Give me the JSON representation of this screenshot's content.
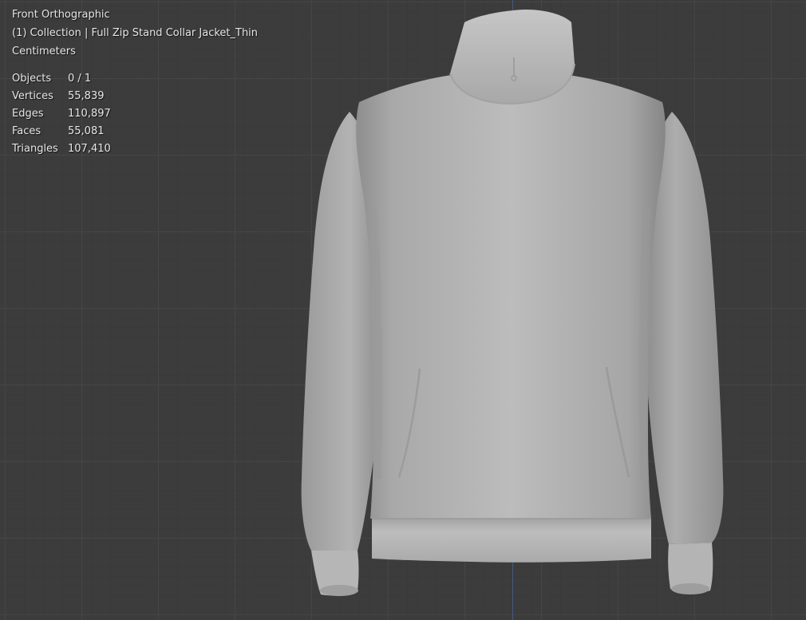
{
  "viewport": {
    "view_name": "Front Orthographic",
    "collection_label": "(1) Collection | Full Zip Stand Collar Jacket_Thin",
    "units": "Centimeters",
    "stats": [
      {
        "label": "Objects",
        "value": "0 / 1"
      },
      {
        "label": "Vertices",
        "value": "55,839"
      },
      {
        "label": "Edges",
        "value": "110,897"
      },
      {
        "label": "Faces",
        "value": "55,081"
      },
      {
        "label": "Triangles",
        "value": "107,410"
      }
    ],
    "colors": {
      "background": "#3c3c3c",
      "grid": "#464646",
      "axis_z": "#3b5fa8",
      "mesh": "#b4b4b4",
      "overlay_text": "#e6e6e6"
    },
    "model_icon": "jacket-mesh"
  }
}
